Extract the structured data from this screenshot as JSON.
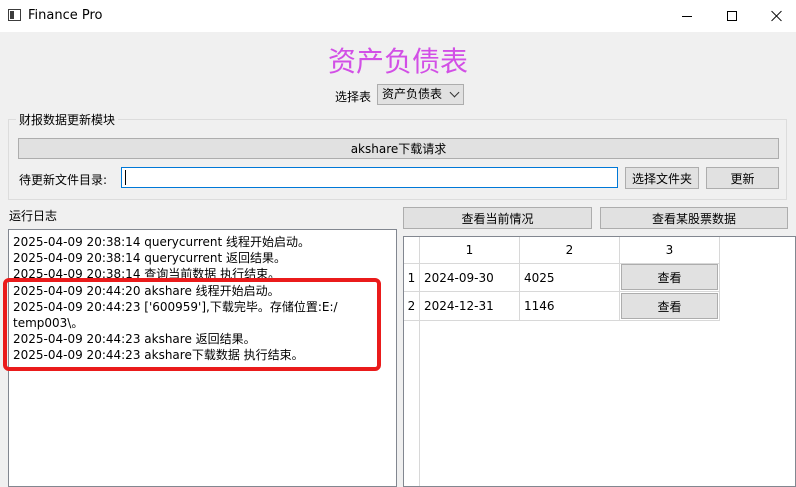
{
  "window": {
    "title": "Finance Pro"
  },
  "heading": "资产负债表",
  "table_select": {
    "label": "选择表",
    "value": "资产负债表"
  },
  "update_module": {
    "title": "财报数据更新模块",
    "download_label": "akshare下载请求",
    "dir_label": "待更新文件目录:",
    "dir_value": "",
    "pick_folder_label": "选择文件夹",
    "update_label": "更新"
  },
  "log": {
    "title": "运行日志",
    "lines": [
      "2025-04-09 20:38:14 querycurrent 线程开始启动。",
      "2025-04-09 20:38:14 querycurrent 返回结果。",
      "2025-04-09 20:38:14 查询当前数据 执行结束。",
      "2025-04-09 20:44:20 akshare 线程开始启动。",
      "2025-04-09 20:44:23 ['600959'],下载完毕。存储位置:E:/",
      "temp003\\。",
      "2025-04-09 20:44:23 akshare 返回结果。",
      "2025-04-09 20:44:23 akshare下载数据 执行结束。"
    ]
  },
  "actions": {
    "view_state_label": "查看当前情况",
    "view_stock_label": "查看某股票数据"
  },
  "table": {
    "columns": [
      "1",
      "2",
      "3"
    ],
    "rows": [
      {
        "index": "1",
        "date": "2024-09-30",
        "value": "4025",
        "action": "查看"
      },
      {
        "index": "2",
        "date": "2024-12-31",
        "value": "1146",
        "action": "查看"
      }
    ]
  },
  "colors": {
    "heading": "#d24fe6",
    "highlight": "#ea1b1b",
    "focus": "#0078d7"
  },
  "icons": {
    "app": "window-icon",
    "minimize": "minimize-icon",
    "maximize": "maximize-icon",
    "close": "close-icon",
    "dropdown": "chevron-down-icon"
  }
}
